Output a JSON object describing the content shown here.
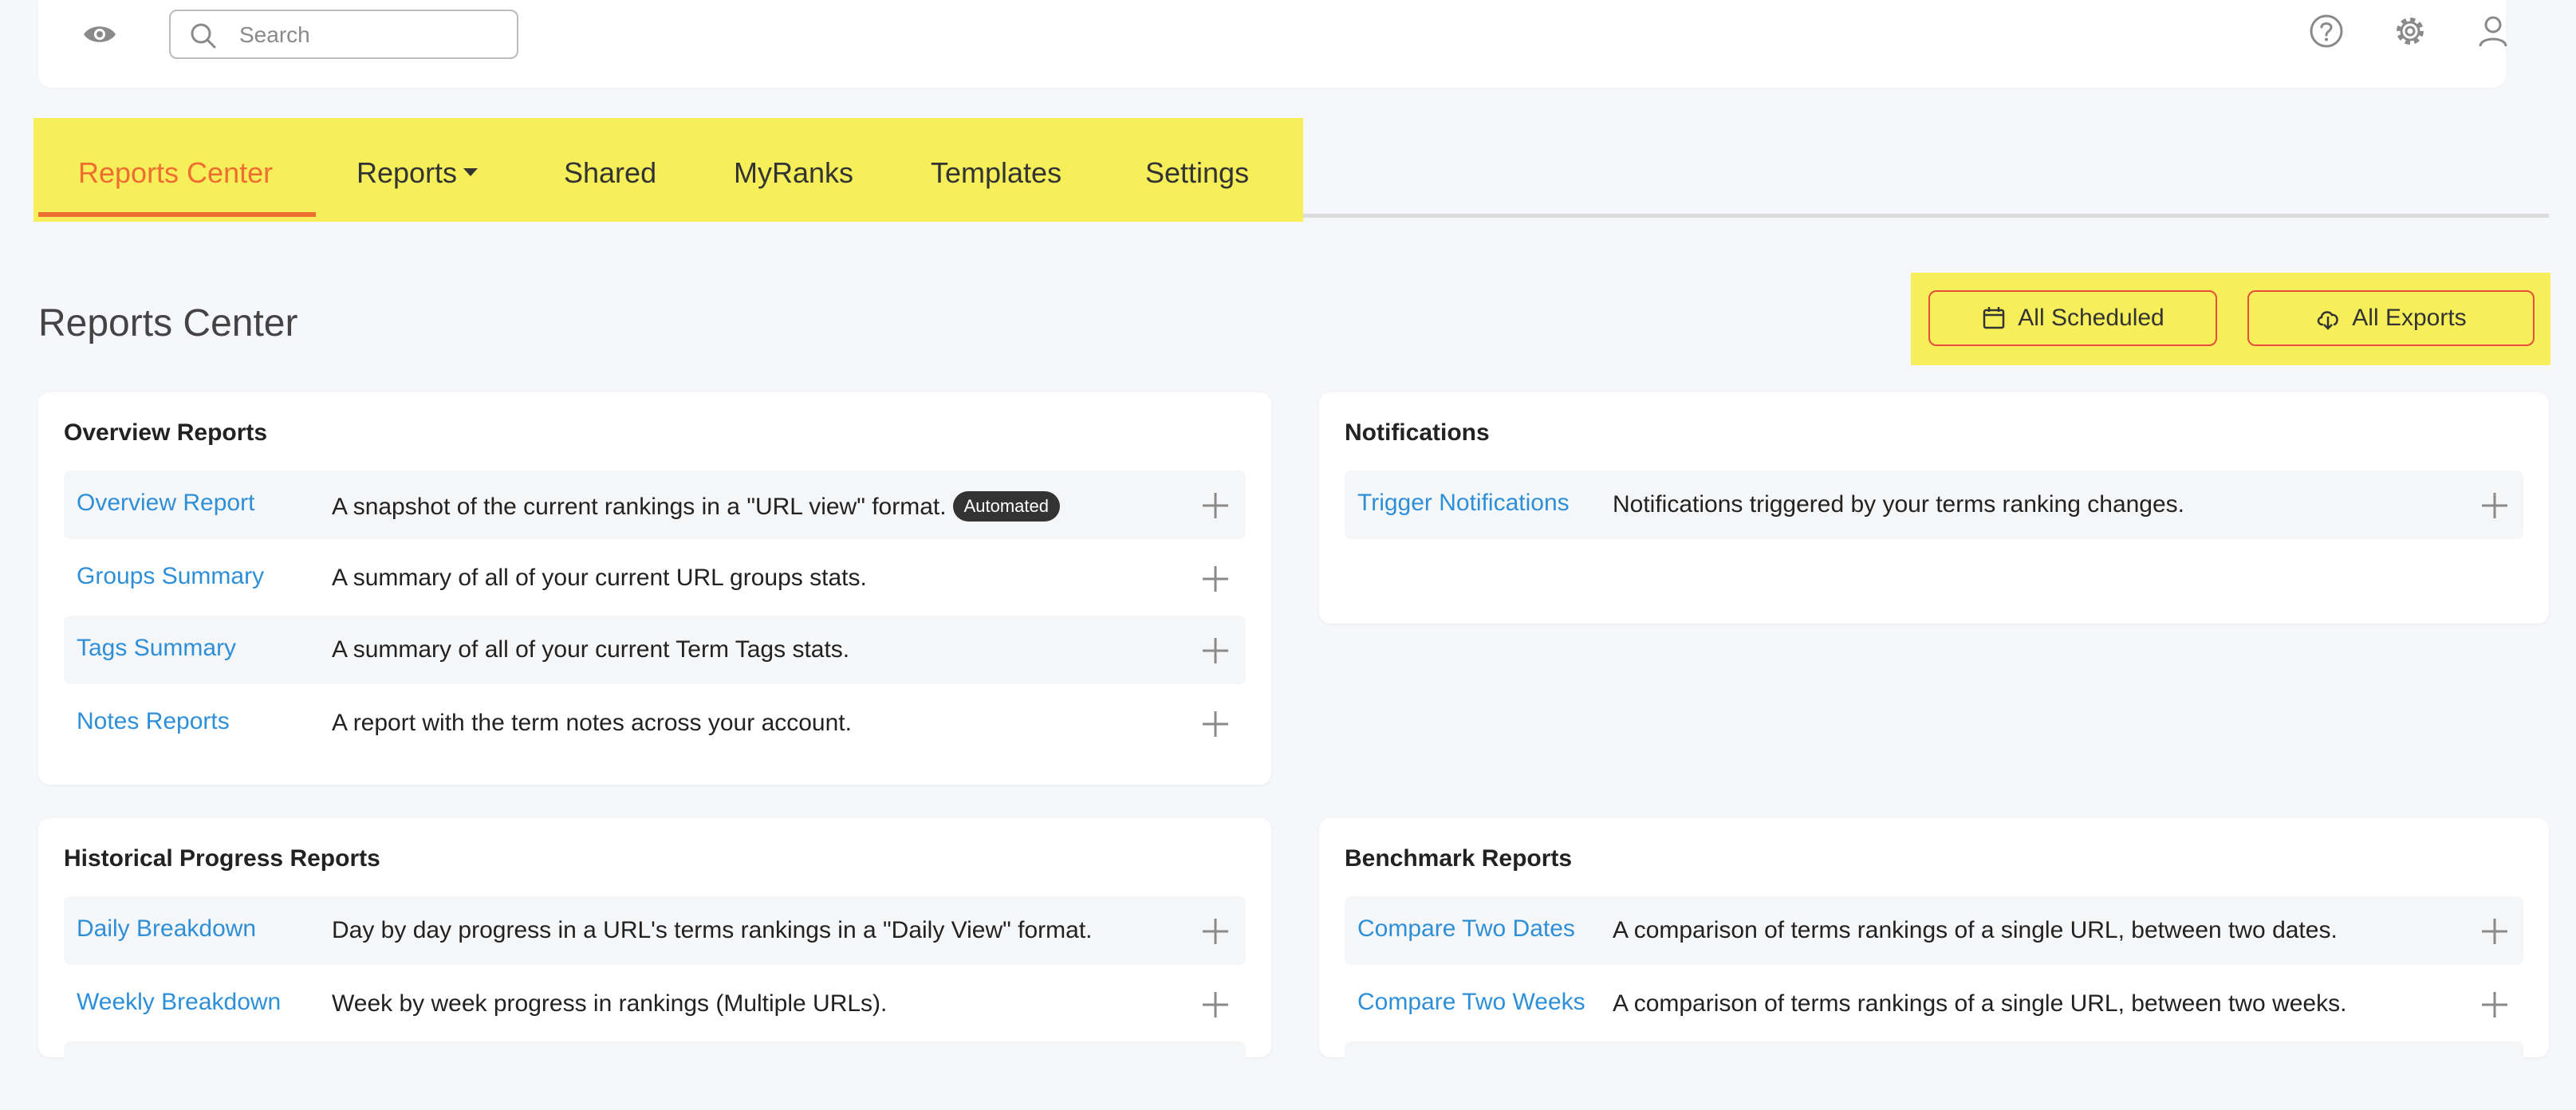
{
  "header": {
    "icons": [
      "eye-icon",
      "help-icon",
      "gear-icon",
      "user-icon"
    ],
    "search": {
      "placeholder": "Search",
      "value": ""
    }
  },
  "nav": {
    "tabs": [
      {
        "label": "Reports Center",
        "active": true
      },
      {
        "label": "Reports",
        "has_dropdown": true
      },
      {
        "label": "Shared"
      },
      {
        "label": "MyRanks"
      },
      {
        "label": "Templates"
      },
      {
        "label": "Settings"
      }
    ]
  },
  "page": {
    "title": "Reports Center",
    "actions": {
      "scheduled": {
        "label": "All Scheduled",
        "icon": "calendar-icon"
      },
      "exports": {
        "label": "All Exports",
        "icon": "cloud-download-icon"
      }
    }
  },
  "cards": {
    "overview": {
      "title": "Overview Reports",
      "rows": [
        {
          "name": "Overview Report",
          "desc": "A snapshot of the current rankings in a \"URL view\" format.",
          "badge": "Automated"
        },
        {
          "name": "Groups Summary",
          "desc": "A summary of all of your current URL groups stats."
        },
        {
          "name": "Tags Summary",
          "desc": "A summary of all of your current Term Tags stats."
        },
        {
          "name": "Notes Reports",
          "desc": "A report with the term notes across your account."
        }
      ]
    },
    "notifications": {
      "title": "Notifications",
      "rows": [
        {
          "name": "Trigger Notifications",
          "desc": "Notifications triggered by your terms ranking changes."
        }
      ]
    },
    "historical": {
      "title": "Historical Progress Reports",
      "rows": [
        {
          "name": "Daily Breakdown",
          "desc": "Day by day progress in a URL's terms rankings in a \"Daily View\" format."
        },
        {
          "name": "Weekly Breakdown",
          "desc": "Week by week progress in rankings (Multiple URLs)."
        }
      ]
    },
    "benchmark": {
      "title": "Benchmark Reports",
      "rows": [
        {
          "name": "Compare Two Dates",
          "desc": "A comparison of terms rankings of a single URL, between two dates."
        },
        {
          "name": "Compare Two Weeks",
          "desc": "A comparison of terms rankings of a single URL, between two weeks."
        }
      ]
    }
  },
  "colors": {
    "accent": "#ee6d31",
    "link": "#2e8fd9",
    "highlight": "#f6ef5a",
    "button_border": "#e74c3c",
    "page_bg": "#f5f7fa"
  }
}
